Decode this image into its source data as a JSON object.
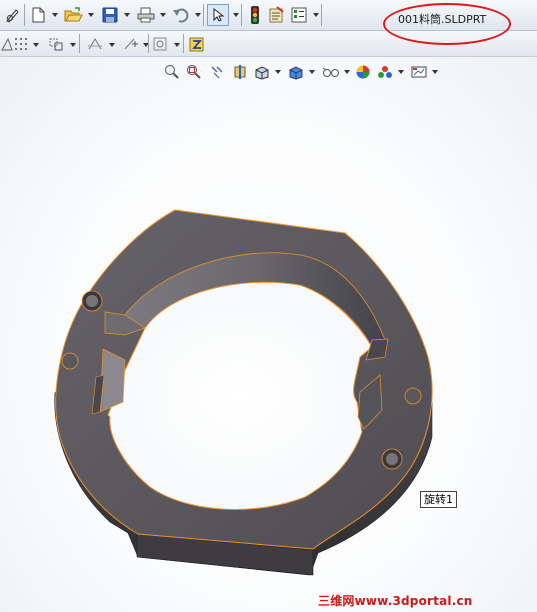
{
  "window": {
    "filename": "001料筒.SLDPRT"
  },
  "model": {
    "feature_tag": "旋转1"
  },
  "watermark": {
    "text": "三维网www.3dportal.cn"
  },
  "icons": {
    "standard_toolbar": [
      "sketch-icon",
      "new-document-icon",
      "open-folder-icon",
      "save-icon",
      "print-icon",
      "undo-icon",
      "select-cursor-icon",
      "rebuild-traffic-light-icon",
      "file-properties-icon",
      "options-icon"
    ],
    "sketch_toolbar": [
      "line-triangle-icon",
      "grid-snap-icon",
      "move-entities-icon",
      "smart-dimension-icon",
      "add-relation-icon",
      "display-relations-icon",
      "quick-snaps-icon"
    ],
    "heads_up_view": [
      "zoom-to-fit-icon",
      "zoom-to-area-icon",
      "previous-view-icon",
      "section-view-icon",
      "view-orientation-icon",
      "display-style-icon",
      "hide-show-items-icon",
      "edit-appearance-icon",
      "apply-scene-icon",
      "view-settings-icon"
    ]
  },
  "colors": {
    "annotation": "#e01818",
    "model_body": "#59575a",
    "model_edge": "#f0902a",
    "watermark": "#d31616"
  }
}
